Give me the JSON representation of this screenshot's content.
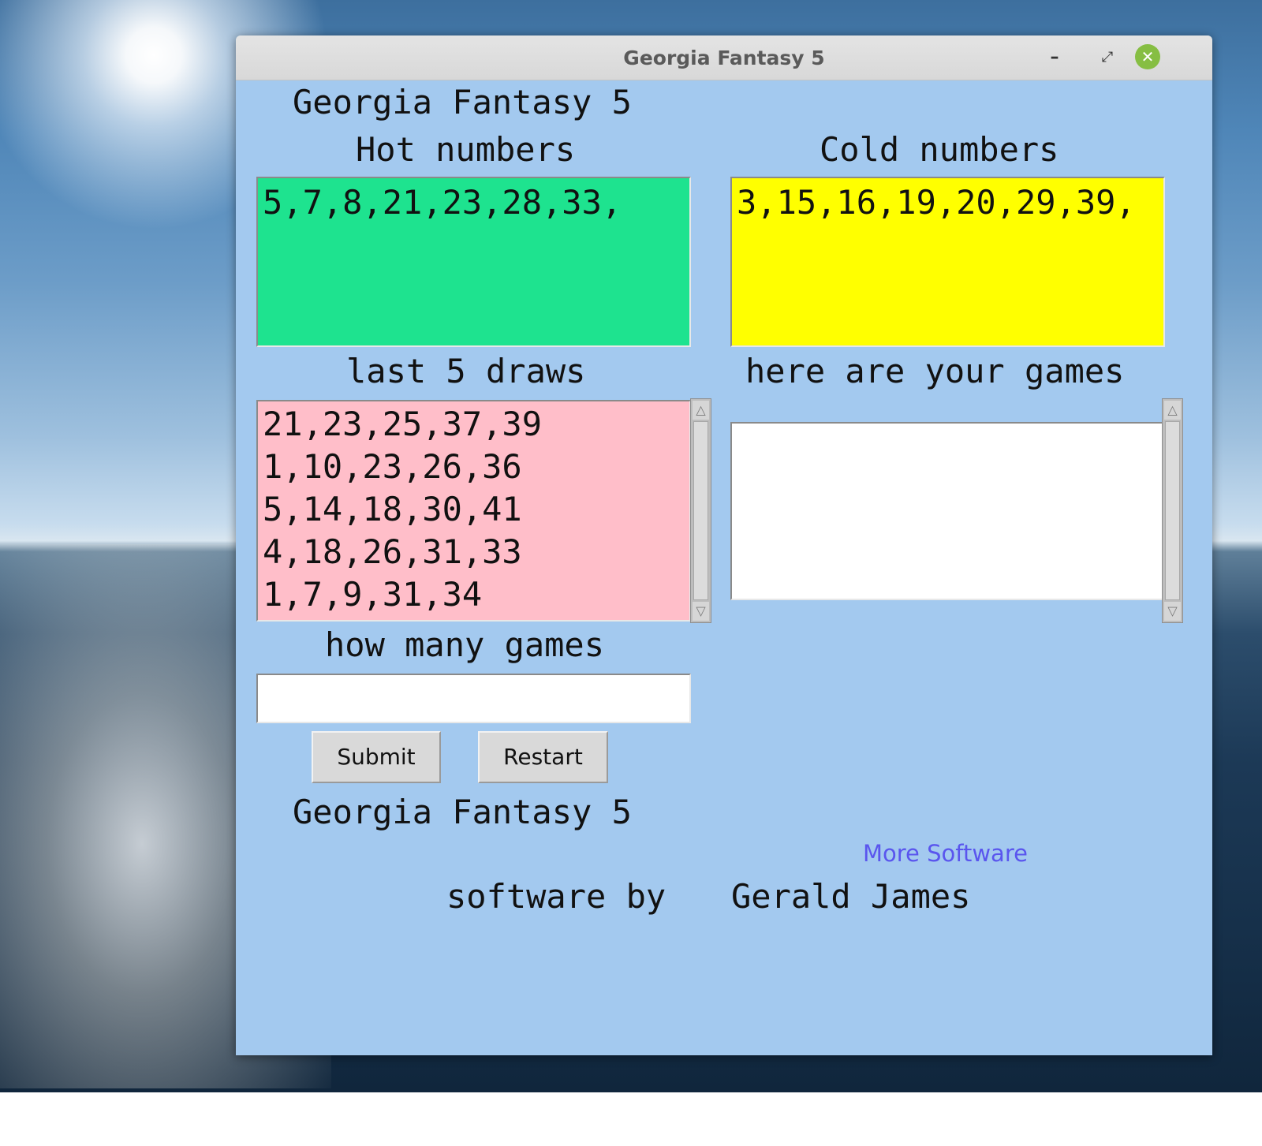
{
  "window": {
    "title": "Georgia Fantasy 5",
    "controls": {
      "minimize": "–",
      "maximize": "⤢",
      "close": "✕"
    }
  },
  "app": {
    "heading": "Georgia Fantasy 5",
    "hot_label": "Hot numbers",
    "hot_value": "5,7,8,21,23,28,33,",
    "cold_label": "Cold numbers",
    "cold_value": "3,15,16,19,20,29,39,",
    "draws_label": "last 5 draws",
    "draws": [
      "21,23,25,37,39",
      "1,10,23,26,36",
      "5,14,18,30,41",
      "4,18,26,31,33",
      "1,7,9,31,34"
    ],
    "games_label": "here are your games",
    "games_value": "",
    "how_many_label": "how many games",
    "how_many_value": "",
    "submit_label": "Submit",
    "restart_label": "Restart",
    "footer_heading": "Georgia Fantasy 5",
    "more_software_link": "More Software",
    "credit_prefix": "software by",
    "credit_name": "Gerald James"
  },
  "colors": {
    "window_bg": "#a3c9ef",
    "hot_bg": "#1ee38f",
    "cold_bg": "#ffff00",
    "draws_bg": "#ffbec9",
    "link": "#5a55ee",
    "close_button": "#86be43"
  }
}
